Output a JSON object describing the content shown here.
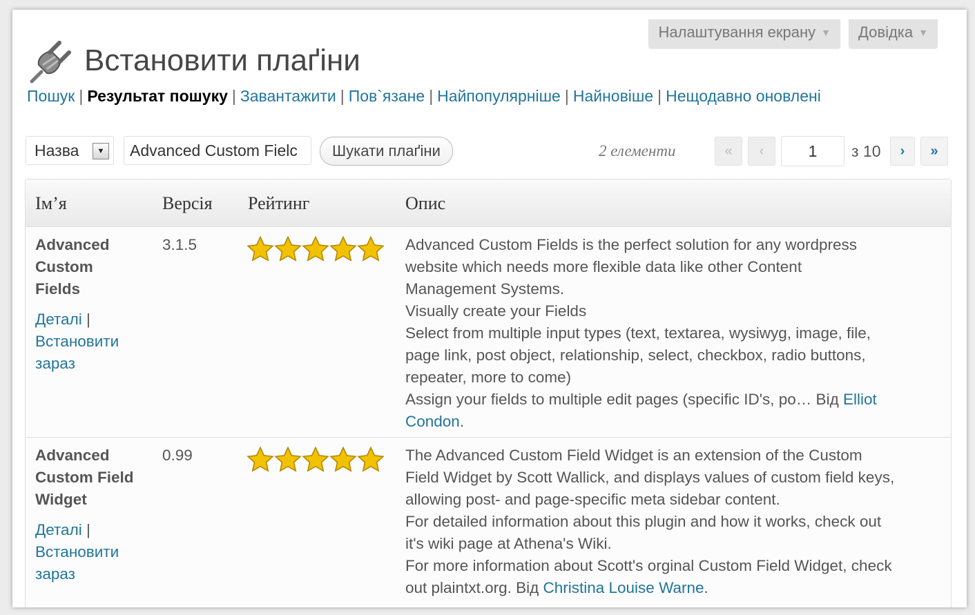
{
  "header": {
    "screen_options": "Налаштування екрану",
    "help": "Довідка",
    "title": "Встановити плаґіни"
  },
  "subnav": {
    "items": [
      {
        "label": "Пошук",
        "current": false
      },
      {
        "label": "Результат пошуку",
        "current": true
      },
      {
        "label": "Завантажити",
        "current": false
      },
      {
        "label": "Пов`язане",
        "current": false
      },
      {
        "label": "Найпопулярніше",
        "current": false
      },
      {
        "label": "Найновіше",
        "current": false
      },
      {
        "label": "Нещодавно оновлені",
        "current": false
      }
    ],
    "separator": "|"
  },
  "toolbar": {
    "search_type": "Назва",
    "search_value": "Advanced Custom Fielc",
    "search_button": "Шукати плаґіни",
    "items_count": "2 елементи",
    "first": "«",
    "prev": "‹",
    "current_page": "1",
    "total_pages": "з 10",
    "next": "›",
    "last": "»"
  },
  "table": {
    "headers": {
      "name": "Ім’я",
      "version": "Версія",
      "rating": "Рейтинг",
      "description": "Опис"
    },
    "rows": [
      {
        "name_lines": [
          "Advanced",
          "Custom",
          "Fields"
        ],
        "details": "Деталі",
        "sep": "|",
        "install_lines": [
          "Встановити",
          "зараз"
        ],
        "version": "3.1.5",
        "rating_stars": 5,
        "desc_lines": [
          "Advanced Custom Fields is the perfect solution for any wordpress",
          "website which needs more flexible data like other Content",
          "Management Systems.",
          "Visually create your Fields",
          "Select from multiple input types (text, textarea, wysiwyg, image, file,",
          "page link, post object, relationship, select, checkbox, radio buttons,",
          "repeater, more to come)",
          "Assign your fields to multiple edit pages (specific ID's, po… Від "
        ],
        "author_part1": "Elliot",
        "author_part2": "Condon",
        "end": "."
      },
      {
        "name_lines": [
          "Advanced",
          "Custom Field",
          "Widget"
        ],
        "details": "Деталі",
        "sep": "|",
        "install_lines": [
          "Встановити",
          "зараз"
        ],
        "version": "0.99",
        "rating_stars": 5,
        "desc_lines": [
          "The Advanced Custom Field Widget is an extension of the Custom",
          "Field Widget by Scott Wallick, and displays values of custom field keys,",
          "allowing post- and page-specific meta sidebar content.",
          "For detailed information about this plugin and how it works, check out",
          "it's wiki page at Athena's Wiki.",
          "For more information about Scott's orginal Custom Field Widget, check",
          "out plaintxt.org. Від "
        ],
        "author": "Christina Louise Warne",
        "end": "."
      }
    ]
  },
  "colors": {
    "link": "#21759b",
    "star": "#f2c200"
  }
}
